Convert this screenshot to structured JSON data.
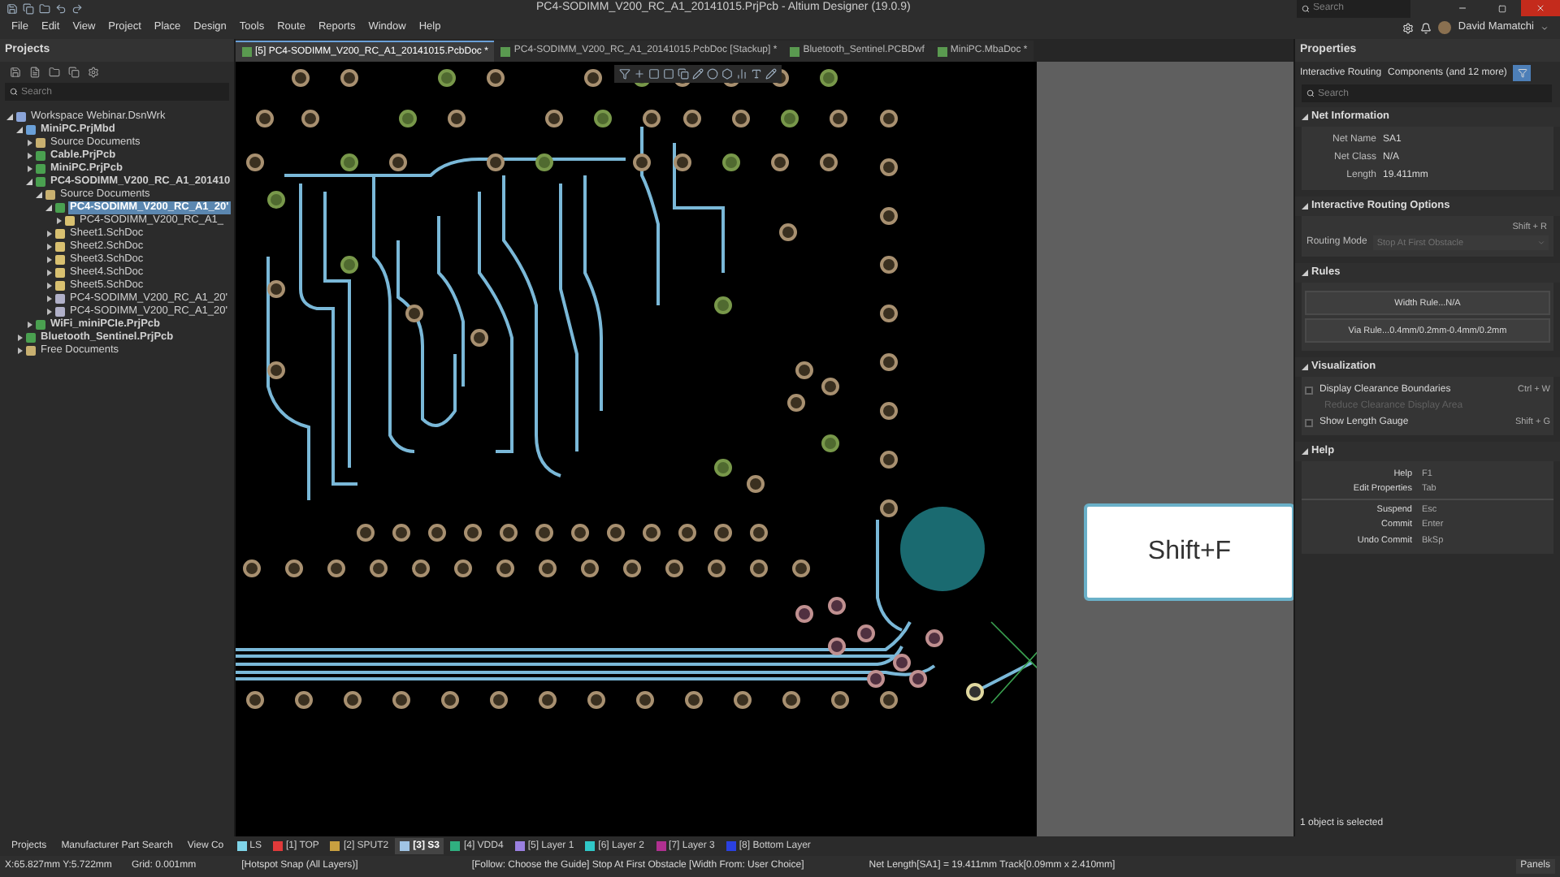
{
  "window": {
    "title": "PC4-SODIMM_V200_RC_A1_20141015.PrjPcb - Altium Designer (19.0.9)",
    "search": {
      "placeholder": "Search"
    }
  },
  "menu": [
    "File",
    "Edit",
    "View",
    "Project",
    "Place",
    "Design",
    "Tools",
    "Route",
    "Reports",
    "Window",
    "Help"
  ],
  "user": {
    "name": "David Mamatchi"
  },
  "projects_panel": {
    "title": "Projects",
    "search": {
      "placeholder": "Search"
    },
    "tree": [
      {
        "label": "Workspace Webinar.DsnWrk",
        "kind": "workspace",
        "selected": false,
        "expanded": true,
        "children": [
          {
            "label": "MiniPC.PrjMbd",
            "kind": "project",
            "selected": false,
            "expanded": true,
            "children": [
              {
                "label": "Source Documents",
                "kind": "folder",
                "selected": false,
                "expanded": false
              },
              {
                "label": "Cable.PrjPcb",
                "kind": "pcbproject",
                "selected": false,
                "expanded": false
              },
              {
                "label": "MiniPC.PrjPcb",
                "kind": "pcbproject",
                "selected": false,
                "expanded": false
              },
              {
                "label": "PC4-SODIMM_V200_RC_A1_201410",
                "kind": "pcbproject",
                "selected": false,
                "expanded": true,
                "children": [
                  {
                    "label": "Source Documents",
                    "kind": "folder",
                    "selected": false,
                    "expanded": true,
                    "children": [
                      {
                        "label": "PC4-SODIMM_V200_RC_A1_20'",
                        "kind": "pcbproject",
                        "selected": true,
                        "expanded": true,
                        "children": [
                          {
                            "label": "PC4-SODIMM_V200_RC_A1_",
                            "kind": "sheet",
                            "selected": false,
                            "expanded": false
                          }
                        ]
                      },
                      {
                        "label": "Sheet1.SchDoc",
                        "kind": "sheet",
                        "selected": false,
                        "expanded": false
                      },
                      {
                        "label": "Sheet2.SchDoc",
                        "kind": "sheet",
                        "selected": false,
                        "expanded": false
                      },
                      {
                        "label": "Sheet3.SchDoc",
                        "kind": "sheet",
                        "selected": false,
                        "expanded": false
                      },
                      {
                        "label": "Sheet4.SchDoc",
                        "kind": "sheet",
                        "selected": false,
                        "expanded": false
                      },
                      {
                        "label": "Sheet5.SchDoc",
                        "kind": "sheet",
                        "selected": false,
                        "expanded": false
                      },
                      {
                        "label": "PC4-SODIMM_V200_RC_A1_20'",
                        "kind": "doc",
                        "selected": false,
                        "expanded": false
                      },
                      {
                        "label": "PC4-SODIMM_V200_RC_A1_20'",
                        "kind": "doc",
                        "selected": false,
                        "expanded": false
                      }
                    ]
                  }
                ]
              },
              {
                "label": "WiFi_miniPCIe.PrjPcb",
                "kind": "pcbproject",
                "selected": false,
                "expanded": false
              }
            ]
          },
          {
            "label": "Bluetooth_Sentinel.PrjPcb",
            "kind": "pcbproject",
            "selected": false,
            "expanded": false
          },
          {
            "label": "Free Documents",
            "kind": "folder",
            "selected": false,
            "expanded": false
          }
        ]
      }
    ]
  },
  "doc_tabs": [
    {
      "label": "[5] PC4-SODIMM_V200_RC_A1_20141015.PcbDoc *",
      "selected": true
    },
    {
      "label": "PC4-SODIMM_V200_RC_A1_20141015.PcbDoc [Stackup] *",
      "selected": false
    },
    {
      "label": "Bluetooth_Sentinel.PCBDwf",
      "selected": false
    },
    {
      "label": "MiniPC.MbaDoc *",
      "selected": false
    }
  ],
  "shortcut_popup": "Shift+F",
  "properties": {
    "title": "Properties",
    "mode": "Interactive Routing",
    "filter": "Components (and 12 more)",
    "search": {
      "placeholder": "Search"
    },
    "net_information": {
      "title": "Net Information",
      "expanded": true,
      "rows": [
        {
          "label": "Net Name",
          "value": "SA1"
        },
        {
          "label": "Net Class",
          "value": "N/A"
        },
        {
          "label": "Length",
          "value": "19.411mm"
        }
      ]
    },
    "routing_options": {
      "title": "Interactive Routing Options",
      "expanded": true,
      "shortcut": "Shift + R",
      "routing_mode": {
        "label": "Routing Mode",
        "value": "Stop At First Obstacle",
        "disabled": true
      }
    },
    "rules": {
      "title": "Rules",
      "expanded": true,
      "buttons": [
        "Width Rule...N/A",
        "Via Rule...0.4mm/0.2mm-0.4mm/0.2mm"
      ]
    },
    "visualization": {
      "title": "Visualization",
      "expanded": true,
      "options": [
        {
          "label": "Display Clearance Boundaries",
          "checked": false,
          "shortcut": "Ctrl + W"
        },
        {
          "label": "Reduce Clearance Display Area",
          "disabled": true
        },
        {
          "label": "Show Length Gauge",
          "checked": false,
          "shortcut": "Shift + G"
        }
      ]
    },
    "help": {
      "title": "Help",
      "expanded": true,
      "groups": [
        [
          {
            "label": "Help",
            "key": "F1"
          },
          {
            "label": "Edit Properties",
            "key": "Tab"
          }
        ],
        [
          {
            "label": "Suspend",
            "key": "Esc"
          },
          {
            "label": "Commit",
            "key": "Enter"
          },
          {
            "label": "Undo Commit",
            "key": "BkSp"
          }
        ]
      ]
    },
    "selection_status": "1 object is selected"
  },
  "panel_tabs": [
    "Projects",
    "Manufacturer Part Search",
    "View Co"
  ],
  "layer_tabs": [
    {
      "label": "LS",
      "color": "#7fd4e8",
      "selected": false
    },
    {
      "label": "[1] TOP",
      "color": "#e03a3a",
      "selected": false
    },
    {
      "label": "[2] SPUT2",
      "color": "#c8a040",
      "selected": false
    },
    {
      "label": "[3] S3",
      "color": "#a0c4e4",
      "selected": true
    },
    {
      "label": "[4] VDD4",
      "color": "#30b080",
      "selected": false
    },
    {
      "label": "[5] Layer 1",
      "color": "#9a80e0",
      "selected": false
    },
    {
      "label": "[6] Layer 2",
      "color": "#30c8c8",
      "selected": false
    },
    {
      "label": "[7] Layer 3",
      "color": "#b03090",
      "selected": false
    },
    {
      "label": "[8] Bottom Layer",
      "color": "#2a40e0",
      "selected": false
    }
  ],
  "status_bar": {
    "coordinates": "X:65.827mm Y:5.722mm",
    "grid": "Grid: 0.001mm",
    "snap": "[Hotspot Snap (All Layers)]",
    "routing": "[Follow: Choose the Guide] Stop At First Obstacle [Width From: User Choice]",
    "net_length": "Net Length[SA1] = 19.411mm Track[0.09mm x 2.410mm]",
    "panels_button": "Panels"
  }
}
